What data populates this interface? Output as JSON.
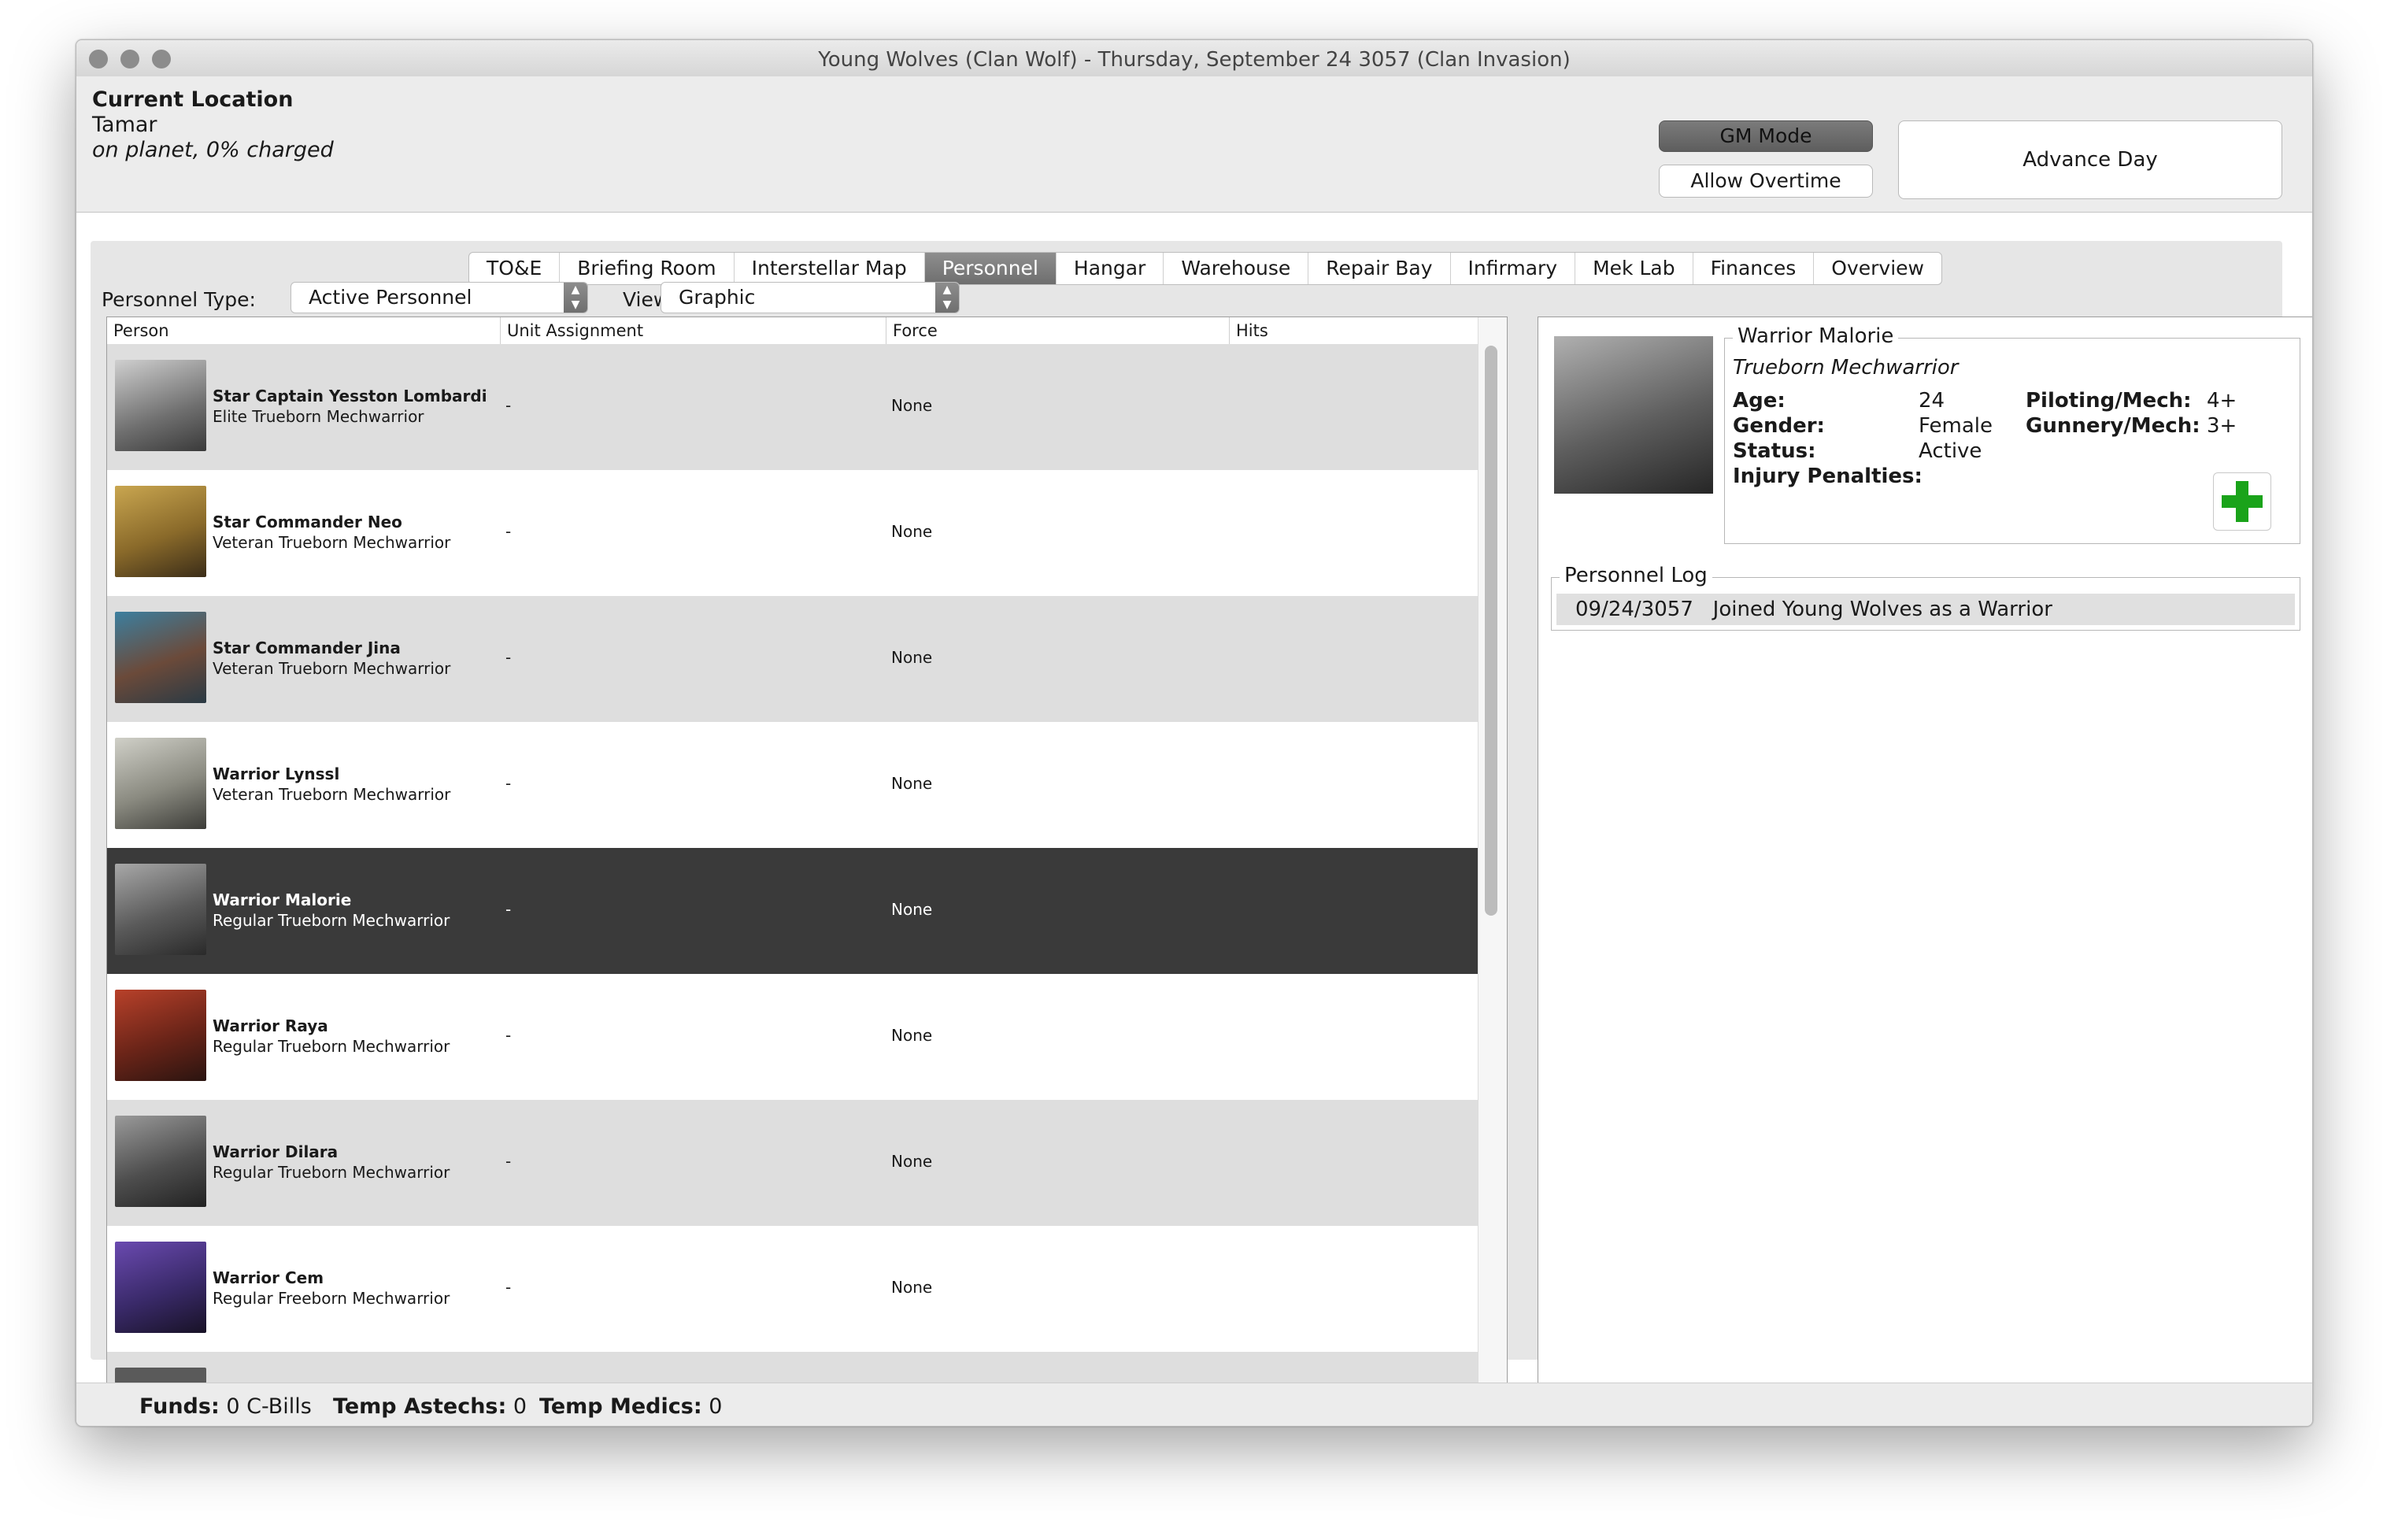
{
  "window": {
    "title": "Young Wolves (Clan Wolf) - Thursday, September 24 3057 (Clan Invasion)"
  },
  "location": {
    "heading": "Current Location",
    "planet": "Tamar",
    "status": "on planet, 0% charged"
  },
  "buttons": {
    "gm_mode": "GM Mode",
    "allow_overtime": "Allow Overtime",
    "advance_day": "Advance Day"
  },
  "tabs": [
    "TO&E",
    "Briefing Room",
    "Interstellar Map",
    "Personnel",
    "Hangar",
    "Warehouse",
    "Repair Bay",
    "Infirmary",
    "Mek Lab",
    "Finances",
    "Overview"
  ],
  "active_tab": "Personnel",
  "filters": {
    "personnel_type_label": "Personnel Type:",
    "personnel_type_value": "Active Personnel",
    "view_label": "View:",
    "view_value": "Graphic"
  },
  "table": {
    "columns": [
      "Person",
      "Unit Assignment",
      "Force",
      "Hits"
    ],
    "rows": [
      {
        "name": "Star Captain Yesston Lombardi",
        "type": "Elite Trueborn Mechwarrior",
        "assignment": "-",
        "force": "None",
        "hits": ""
      },
      {
        "name": "Star Commander Neo",
        "type": "Veteran Trueborn Mechwarrior",
        "assignment": "-",
        "force": "None",
        "hits": ""
      },
      {
        "name": "Star Commander Jina",
        "type": "Veteran Trueborn Mechwarrior",
        "assignment": "-",
        "force": "None",
        "hits": ""
      },
      {
        "name": "Warrior Lynssl",
        "type": "Veteran Trueborn Mechwarrior",
        "assignment": "-",
        "force": "None",
        "hits": ""
      },
      {
        "name": "Warrior Malorie",
        "type": "Regular Trueborn Mechwarrior",
        "assignment": "-",
        "force": "None",
        "hits": ""
      },
      {
        "name": "Warrior Raya",
        "type": "Regular Trueborn Mechwarrior",
        "assignment": "-",
        "force": "None",
        "hits": ""
      },
      {
        "name": "Warrior Dilara",
        "type": "Regular Trueborn Mechwarrior",
        "assignment": "-",
        "force": "None",
        "hits": ""
      },
      {
        "name": "Warrior Cem",
        "type": "Regular Freeborn Mechwarrior",
        "assignment": "-",
        "force": "None",
        "hits": ""
      }
    ],
    "selected_index": 4
  },
  "detail": {
    "name": "Warrior Malorie",
    "subtitle": "Trueborn Mechwarrior",
    "age_label": "Age:",
    "age": "24",
    "gender_label": "Gender:",
    "gender": "Female",
    "status_label": "Status:",
    "status": "Active",
    "injury_label": "Injury Penalties:",
    "piloting_label": "Piloting/Mech:",
    "piloting": "4+",
    "gunnery_label": "Gunnery/Mech:",
    "gunnery": "3+",
    "log_title": "Personnel Log",
    "log": [
      {
        "date": "09/24/3057",
        "text": "Joined Young Wolves as a Warrior"
      }
    ]
  },
  "statusbar": {
    "funds_label": "Funds:",
    "funds": "0 C-Bills",
    "astechs_label": "Temp Astechs:",
    "astechs": "0",
    "medics_label": "Temp Medics:",
    "medics": "0"
  },
  "colors": {
    "selected_row": "#3a3a3a",
    "active_tab": "#7a7a7a",
    "heal_plus": "#1aa31a"
  }
}
